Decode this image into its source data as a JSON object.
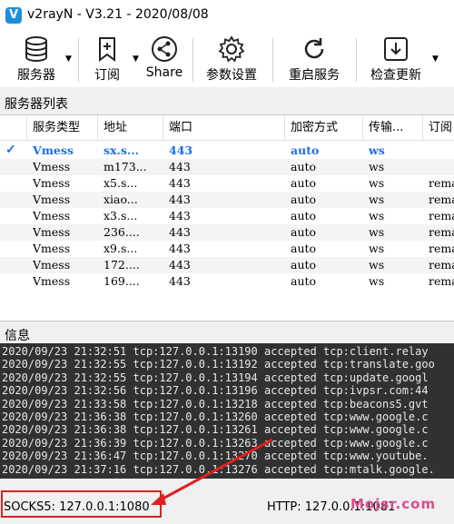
{
  "window": {
    "title": "v2rayN - V3.21 - 2020/08/08",
    "icon_letter": "V"
  },
  "toolbar": {
    "servers": "服务器",
    "subscribe": "订阅",
    "share": "Share",
    "settings": "参数设置",
    "restart": "重启服务",
    "update": "检查更新"
  },
  "server_list": {
    "label": "服务器列表",
    "headers": [
      "服务类型",
      "地址",
      "端口",
      "加密方式",
      "传输...",
      "订阅"
    ],
    "rows": [
      {
        "type": "Vmess",
        "address": "sx.s...",
        "port": "443",
        "security": "auto",
        "network": "ws",
        "sub": "",
        "selected": true
      },
      {
        "type": "Vmess",
        "address": "m173...",
        "port": "443",
        "security": "auto",
        "network": "ws",
        "sub": ""
      },
      {
        "type": "Vmess",
        "address": "x5.s...",
        "port": "443",
        "security": "auto",
        "network": "ws",
        "sub": "rema"
      },
      {
        "type": "Vmess",
        "address": "xiao...",
        "port": "443",
        "security": "auto",
        "network": "ws",
        "sub": "rema"
      },
      {
        "type": "Vmess",
        "address": "x3.s...",
        "port": "443",
        "security": "auto",
        "network": "ws",
        "sub": "rema"
      },
      {
        "type": "Vmess",
        "address": "236....",
        "port": "443",
        "security": "auto",
        "network": "ws",
        "sub": "rema"
      },
      {
        "type": "Vmess",
        "address": "x9.s...",
        "port": "443",
        "security": "auto",
        "network": "ws",
        "sub": "rema"
      },
      {
        "type": "Vmess",
        "address": "172....",
        "port": "443",
        "security": "auto",
        "network": "ws",
        "sub": "rema"
      },
      {
        "type": "Vmess",
        "address": "169....",
        "port": "443",
        "security": "auto",
        "network": "ws",
        "sub": "rema"
      }
    ]
  },
  "info": {
    "label": "信息",
    "lines": [
      "2020/09/23 21:32:51 tcp:127.0.0.1:13190 accepted tcp:client.relay",
      "2020/09/23 21:32:55 tcp:127.0.0.1:13192 accepted tcp:translate.goo",
      "2020/09/23 21:32:55 tcp:127.0.0.1:13194 accepted tcp:update.googl",
      "2020/09/23 21:32:56 tcp:127.0.0.1:13196 accepted tcp:ivpsr.com:44",
      "2020/09/23 21:33:58 tcp:127.0.0.1:13218 accepted tcp:beacons5.gvt",
      "2020/09/23 21:36:38 tcp:127.0.0.1:13260 accepted tcp:www.google.c",
      "2020/09/23 21:36:38 tcp:127.0.0.1:13261 accepted tcp:www.google.c",
      "2020/09/23 21:36:39 tcp:127.0.0.1:13263 accepted tcp:www.google.c",
      "2020/09/23 21:36:47 tcp:127.0.0.1:13270 accepted tcp:www.youtube.",
      "2020/09/23 21:37:16 tcp:127.0.0.1:13276 accepted tcp:mtalk.google."
    ]
  },
  "status": {
    "socks": "SOCKS5:  127.0.0.1:1080",
    "http": "HTTP:  127.0.0.1:1081"
  },
  "watermark": "Mojsr.com",
  "colors": {
    "accent": "#1a6ee8",
    "highlight_box": "#e02020",
    "log_bg": "#2f3132"
  }
}
